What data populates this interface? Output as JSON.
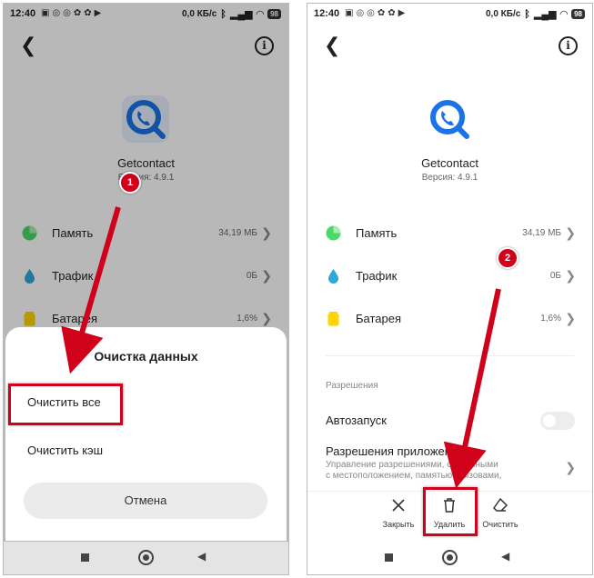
{
  "status_bar": {
    "time": "12:40",
    "speed": "0,0 КБ/с",
    "battery": "98"
  },
  "app": {
    "name": "Getcontact",
    "version": "Версия: 4.9.1"
  },
  "info_rows": [
    {
      "label": "Память",
      "value": "34,19 МБ",
      "color": "#4cd964"
    },
    {
      "label": "Трафик",
      "value": "0Б",
      "color": "#2fa8e0"
    },
    {
      "label": "Батарея",
      "value": "1,6%",
      "color": "#ffd400"
    }
  ],
  "clear_dialog": {
    "title": "Очистка данных",
    "option_all": "Очистить все",
    "option_cache": "Очистить кэш",
    "cancel": "Отмена"
  },
  "permissions": {
    "section": "Разрешения",
    "autostart": "Автозапуск",
    "app_permissions": "Разрешения приложений",
    "desc_line1": "Управление разрешениями, связанными",
    "desc_line2": "с местоположением, памятью, вызовами,"
  },
  "actions": {
    "close": "Закрыть",
    "delete": "Удалить",
    "clear": "Очистить"
  },
  "steps": {
    "step1": "1",
    "step2": "2"
  },
  "colors": {
    "accent_red": "#d0021b",
    "app_blue": "#1a73e8"
  }
}
